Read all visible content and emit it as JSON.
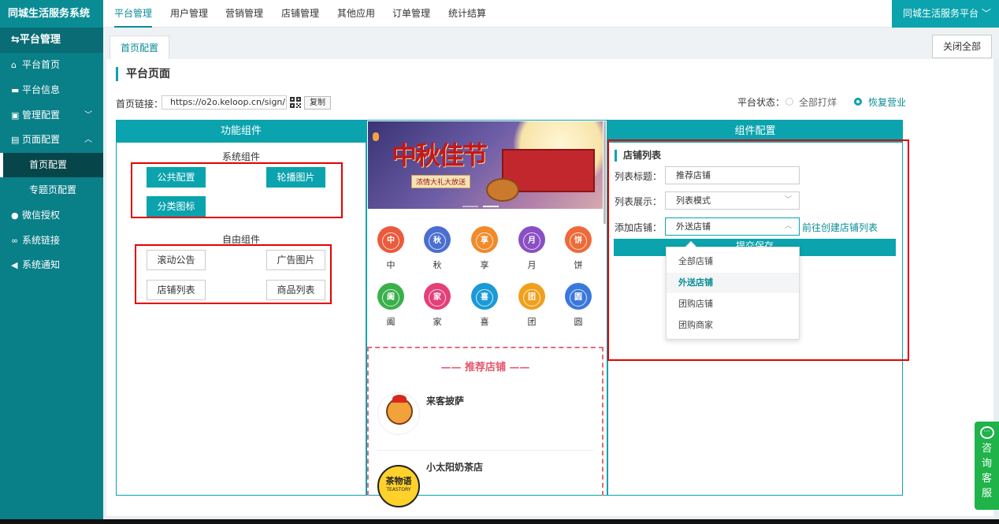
{
  "app": {
    "brand": "同城生活服务系统",
    "platform_selector": "同城生活服务平台"
  },
  "top_nav": [
    "平台管理",
    "用户管理",
    "营销管理",
    "店铺管理",
    "其他应用",
    "订单管理",
    "统计结算"
  ],
  "sidebar": {
    "header": "平台管理",
    "items": [
      {
        "label": "平台首页",
        "icon": "home-icon"
      },
      {
        "label": "平台信息",
        "icon": "monitor-icon"
      },
      {
        "label": "管理配置",
        "icon": "image-icon"
      },
      {
        "label": "页面配置",
        "icon": "document-icon"
      },
      {
        "label": "首页配置",
        "icon": ""
      },
      {
        "label": "专题页配置",
        "icon": ""
      },
      {
        "label": "微信授权",
        "icon": "wechat-icon"
      },
      {
        "label": "系统链接",
        "icon": "link-icon"
      },
      {
        "label": "系统通知",
        "icon": "speaker-icon"
      }
    ]
  },
  "tabs": {
    "active": "首页配置",
    "close_all": "关闭全部"
  },
  "page": {
    "title": "平台页面",
    "link_label": "首页链接：",
    "link_value": "https://o2o.keloop.cn/sign/",
    "copy_label": "复制",
    "status_label": "平台状态：",
    "status_options": [
      "全部打烊",
      "恢复营业"
    ],
    "status_selected": "恢复营业"
  },
  "components": {
    "header": "功能组件",
    "system_title": "系统组件",
    "system": [
      "公共配置",
      "轮播图片",
      "分类图标"
    ],
    "free_title": "自由组件",
    "free": [
      "滚动公告",
      "广告图片",
      "店铺列表",
      "商品列表"
    ]
  },
  "preview": {
    "banner_title": "中秋佳节",
    "banner_subtitle": "浓情大礼大放送",
    "categories": [
      {
        "char": "中",
        "label": "中",
        "color": "#ea5a3c"
      },
      {
        "char": "秋",
        "label": "秋",
        "color": "#4a6fd1"
      },
      {
        "char": "享",
        "label": "享",
        "color": "#f08a2a"
      },
      {
        "char": "月",
        "label": "月",
        "color": "#8b4fc4"
      },
      {
        "char": "饼",
        "label": "饼",
        "color": "#ee6a3a"
      },
      {
        "char": "阖",
        "label": "阖",
        "color": "#3ab04a"
      },
      {
        "char": "家",
        "label": "家",
        "color": "#e53f79"
      },
      {
        "char": "喜",
        "label": "喜",
        "color": "#1a9ad6"
      },
      {
        "char": "团",
        "label": "团",
        "color": "#f0a01c"
      },
      {
        "char": "圆",
        "label": "圆",
        "color": "#3a78dc"
      }
    ],
    "rec_title": "推荐店铺",
    "shops": [
      "来客披萨",
      "小太阳奶茶店"
    ],
    "shop_logo_text": [
      "",
      "茶物语"
    ],
    "shop_logo_subtext": [
      "",
      "TEASTORY"
    ]
  },
  "config": {
    "header": "组件配置",
    "section": "店铺列表",
    "fields": [
      {
        "label": "列表标题：",
        "value": "推荐店铺"
      },
      {
        "label": "列表展示：",
        "value": "列表模式"
      },
      {
        "label": "添加店铺：",
        "value": "外送店铺"
      }
    ],
    "goto_link": "前往创建店铺列表",
    "save_label": "提交保存",
    "dropdown_options": [
      "全部店铺",
      "外送店铺",
      "团购店铺",
      "团购商家"
    ],
    "dropdown_selected": "外送店铺"
  },
  "chat": {
    "label": [
      "咨",
      "询",
      "客",
      "服"
    ]
  },
  "colors": {
    "primary": "#0aa3ae",
    "sidebar": "#097f88",
    "highlight": "#e40000"
  }
}
